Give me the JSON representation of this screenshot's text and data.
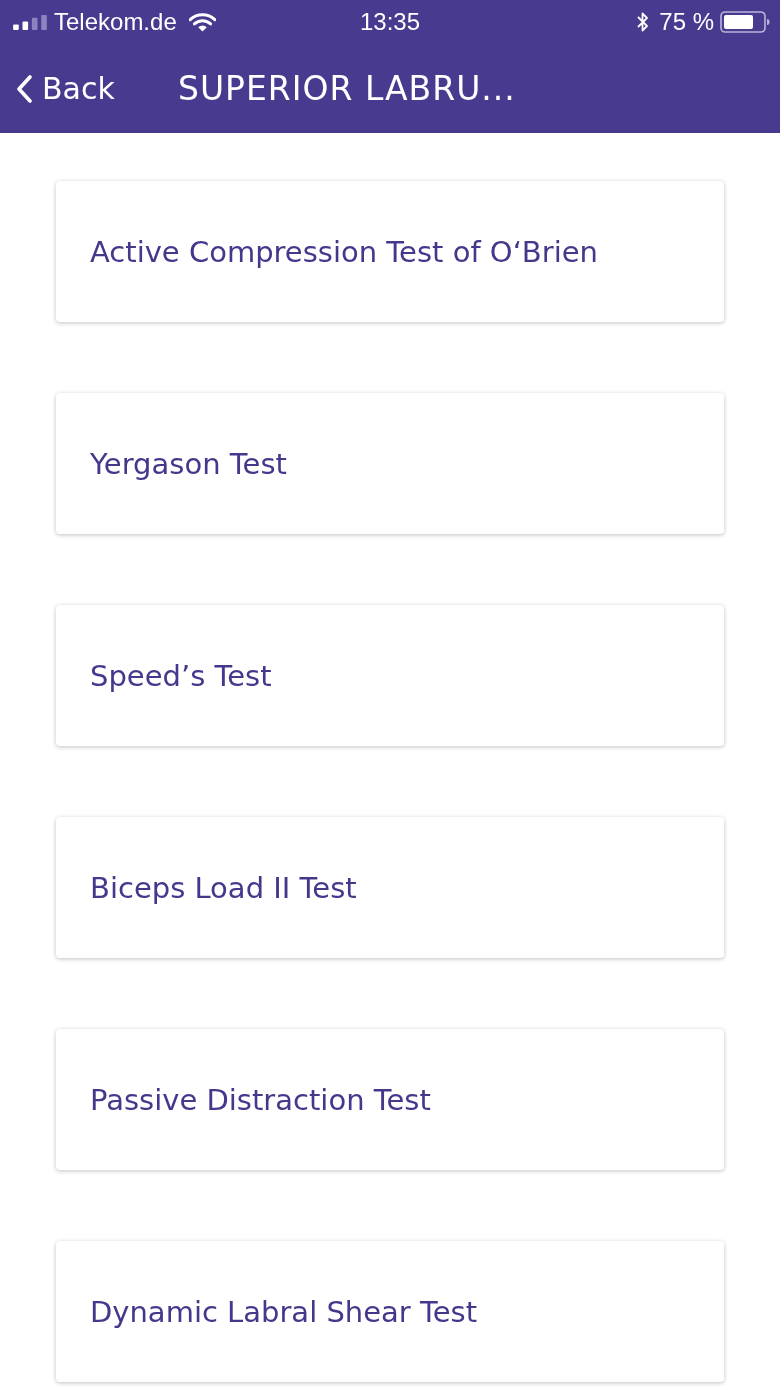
{
  "status_bar": {
    "carrier": "Telekom.de",
    "time": "13:35",
    "battery": "75 %"
  },
  "nav_bar": {
    "back": "Back",
    "title": "SUPERIOR LABRU..."
  },
  "tests": [
    {
      "label": "Active Compression Test of O‘Brien"
    },
    {
      "label": "Yergason Test"
    },
    {
      "label": "Speed’s Test"
    },
    {
      "label": "Biceps Load II Test"
    },
    {
      "label": "Passive Distraction Test"
    },
    {
      "label": "Dynamic Labral Shear Test"
    }
  ]
}
